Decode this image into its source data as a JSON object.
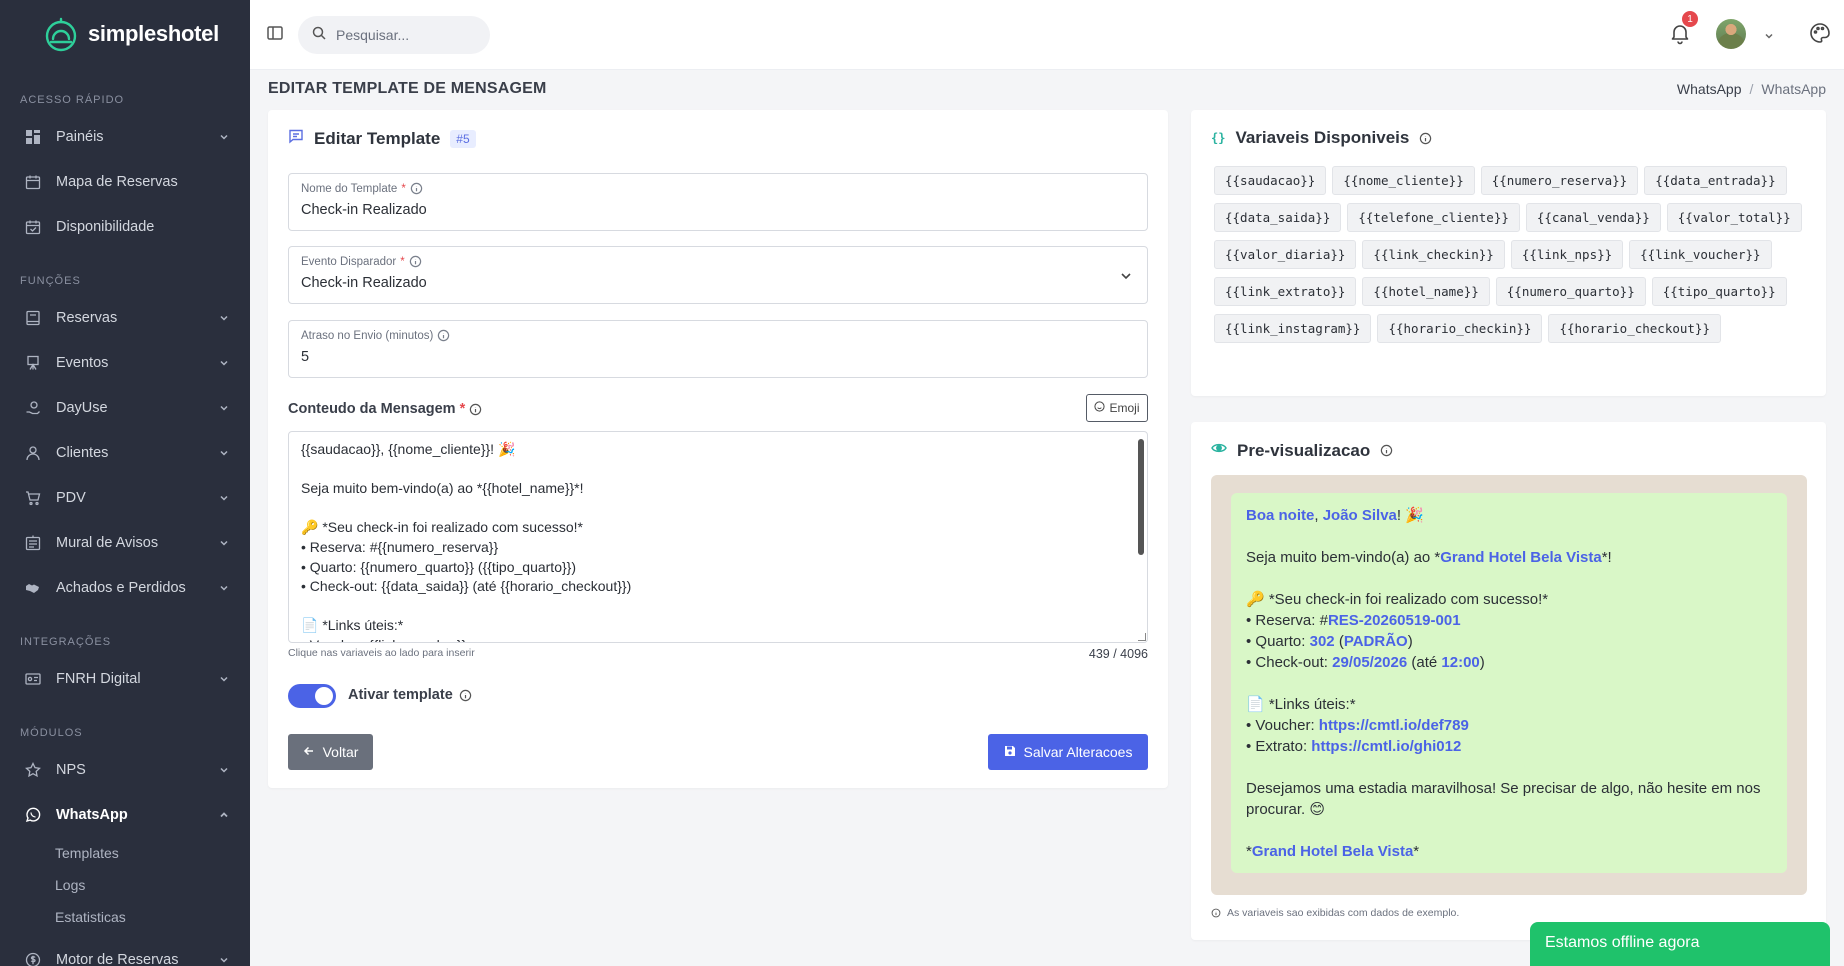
{
  "brand": {
    "name": "simpleshotel",
    "accent": "#4b63e6",
    "sidebar_bg": "#2a2f3d",
    "logo_color": "#2ecf9a"
  },
  "sidebar": {
    "sections": [
      {
        "title": "ACESSO RÁPIDO",
        "items": [
          {
            "label": "Painéis",
            "icon": "dashboard-icon",
            "chevron": true
          },
          {
            "label": "Mapa de Reservas",
            "icon": "calendar-icon",
            "chevron": false
          },
          {
            "label": "Disponibilidade",
            "icon": "calendar-check-icon",
            "chevron": false
          }
        ]
      },
      {
        "title": "FUNÇÕES",
        "items": [
          {
            "label": "Reservas",
            "icon": "book-icon",
            "chevron": true
          },
          {
            "label": "Eventos",
            "icon": "easel-icon",
            "chevron": true
          },
          {
            "label": "DayUse",
            "icon": "sun-hand-icon",
            "chevron": true
          },
          {
            "label": "Clientes",
            "icon": "user-icon",
            "chevron": true
          },
          {
            "label": "PDV",
            "icon": "cart-icon",
            "chevron": true
          },
          {
            "label": "Mural de Avisos",
            "icon": "board-icon",
            "chevron": true
          },
          {
            "label": "Achados e Perdidos",
            "icon": "handshake-icon",
            "chevron": true
          }
        ]
      },
      {
        "title": "INTEGRAÇÕES",
        "items": [
          {
            "label": "FNRH Digital",
            "icon": "id-card-icon",
            "chevron": true
          }
        ]
      },
      {
        "title": "MÓDULOS",
        "items": [
          {
            "label": "NPS",
            "icon": "star-icon",
            "chevron": true
          },
          {
            "label": "WhatsApp",
            "icon": "whatsapp-icon",
            "chevron": true,
            "active": true
          }
        ]
      }
    ],
    "whatsapp_sub": [
      "Templates",
      "Logs",
      "Estatisticas"
    ],
    "motor": {
      "label": "Motor de Reservas",
      "icon": "dollar-circle-icon"
    }
  },
  "topbar": {
    "search_placeholder": "Pesquisar...",
    "notification_count": "1"
  },
  "page": {
    "title": "EDITAR TEMPLATE DE MENSAGEM",
    "breadcrumb": [
      "WhatsApp",
      "WhatsApp"
    ]
  },
  "editor": {
    "title": "Editar Template",
    "id_badge": "#5",
    "name_label": "Nome do Template",
    "name_value": "Check-in Realizado",
    "event_label": "Evento Disparador",
    "event_value": "Check-in Realizado",
    "delay_label": "Atraso no Envio (minutos)",
    "delay_value": "5",
    "content_label": "Conteudo da Mensagem",
    "emoji_label": "Emoji",
    "content": "{{saudacao}}, {{nome_cliente}}! 🎉\n\nSeja muito bem-vindo(a) ao *{{hotel_name}}*!\n\n🔑 *Seu check-in foi realizado com sucesso!*\n• Reserva: #{{numero_reserva}}\n• Quarto: {{numero_quarto}} ({{tipo_quarto}})\n• Check-out: {{data_saida}} (até {{horario_checkout}})\n\n📄 *Links úteis:*\n• Voucher: {{link_voucher}}",
    "hint": "Clique nas variaveis ao lado para inserir",
    "char_count": "439 / 4096",
    "toggle_label": "Ativar template",
    "back_label": "Voltar",
    "save_label": "Salvar Alteracoes"
  },
  "variables": {
    "title": "Variaveis Disponiveis",
    "items": [
      "{{saudacao}}",
      "{{nome_cliente}}",
      "{{numero_reserva}}",
      "{{data_entrada}}",
      "{{data_saida}}",
      "{{telefone_cliente}}",
      "{{canal_venda}}",
      "{{valor_total}}",
      "{{valor_diaria}}",
      "{{link_checkin}}",
      "{{link_nps}}",
      "{{link_voucher}}",
      "{{link_extrato}}",
      "{{hotel_name}}",
      "{{numero_quarto}}",
      "{{tipo_quarto}}",
      "{{link_instagram}}",
      "{{horario_checkin}}",
      "{{horario_checkout}}"
    ]
  },
  "preview": {
    "title": "Pre-visualizacao",
    "greeting": "Boa noite",
    "client": "João Silva",
    "hotel": "Grand Hotel Bela Vista",
    "welcome_prefix": "Seja muito bem-vindo(a) ao *",
    "checkin_line": "🔑 *Seu check-in foi realizado com sucesso!*",
    "reserva_prefix": "• Reserva: #",
    "reserva": "RES-20260519-001",
    "quarto_prefix": "• Quarto: ",
    "quarto": "302",
    "tipo": "PADRÃO",
    "checkout_prefix": "• Check-out: ",
    "checkout_date": "29/05/2026",
    "checkout_time": "12:00",
    "links_line": "📄 *Links úteis:*",
    "voucher_prefix": "• Voucher: ",
    "voucher": "https://cmtl.io/def789",
    "extrato_prefix": "• Extrato: ",
    "extrato": "https://cmtl.io/ghi012",
    "closing": "Desejamos uma estadia maravilhosa! Se precisar de algo, não hesite em nos procurar. 😊",
    "note": "As variaveis sao exibidas com dados de exemplo."
  },
  "chat_widget": {
    "label": "Estamos offline agora"
  }
}
